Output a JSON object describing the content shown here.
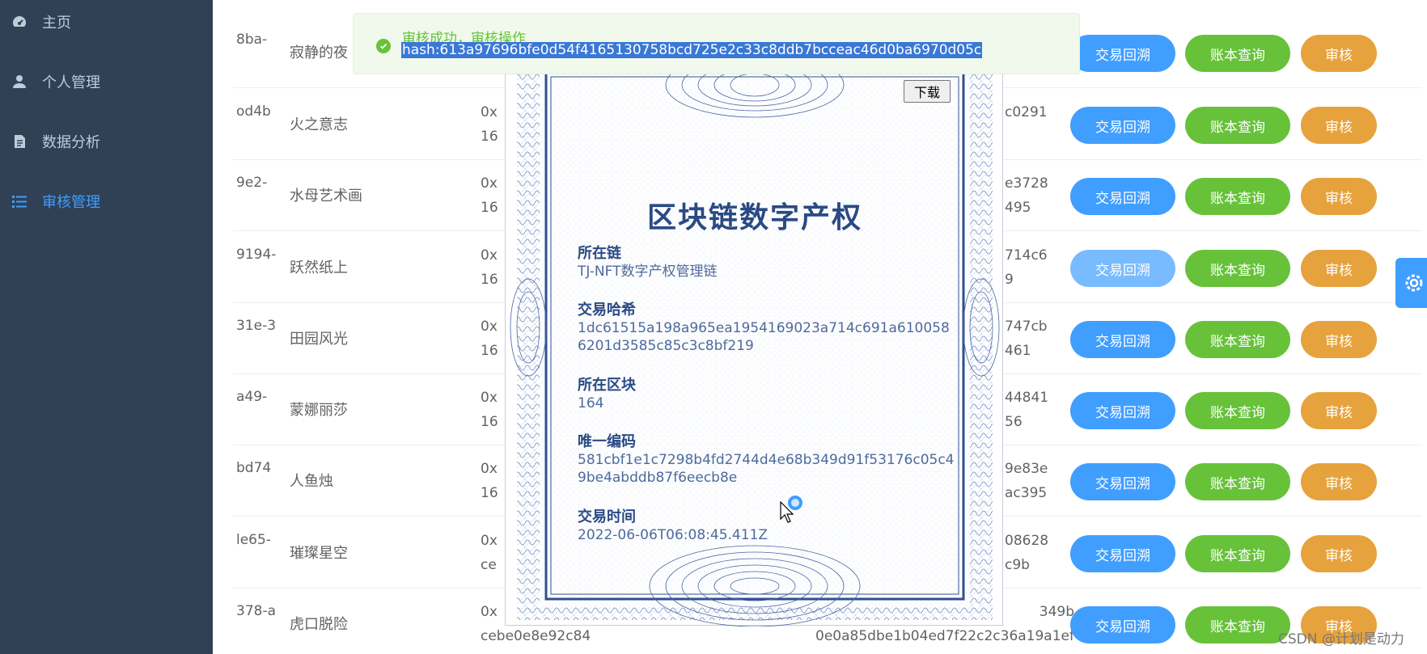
{
  "sidebar": {
    "items": [
      {
        "label": "主页",
        "icon": "dashboard-icon",
        "active": false
      },
      {
        "label": "个人管理",
        "icon": "user-icon",
        "active": false
      },
      {
        "label": "数据分析",
        "icon": "document-icon",
        "active": false
      },
      {
        "label": "审核管理",
        "icon": "list-icon",
        "active": true
      }
    ]
  },
  "table": {
    "rows": [
      {
        "id": "8ba-",
        "name": "寂静的夜",
        "hash1": "",
        "hash2": "",
        "trace": "交易回溯",
        "ledger": "账本查询",
        "audit": "审核"
      },
      {
        "id": "od4b",
        "name": "火之意志",
        "hash1": "0x\n16",
        "hash2": "c0291",
        "trace": "交易回溯",
        "ledger": "账本查询",
        "audit": "审核"
      },
      {
        "id": "9e2-",
        "name": "水母艺术画",
        "hash1": "0x\n16",
        "hash2": "e3728\n495",
        "trace": "交易回溯",
        "ledger": "账本查询",
        "audit": "审核"
      },
      {
        "id": "9194-",
        "name": "跃然纸上",
        "hash1": "0x\n16",
        "hash2": "714c6\n9",
        "trace": "交易回溯",
        "ledger": "账本查询",
        "audit": "审核"
      },
      {
        "id": "31e-3",
        "name": "田园风光",
        "hash1": "0x\n16",
        "hash2": "747cb\n461",
        "trace": "交易回溯",
        "ledger": "账本查询",
        "audit": "审核"
      },
      {
        "id": "a49-",
        "name": "蒙娜丽莎",
        "hash1": "0x\n16",
        "hash2": "44841\n56",
        "trace": "交易回溯",
        "ledger": "账本查询",
        "audit": "审核"
      },
      {
        "id": "bd74",
        "name": "人鱼烛",
        "hash1": "0x\n16",
        "hash2": "9e83e\nac395",
        "trace": "交易回溯",
        "ledger": "账本查询",
        "audit": "审核"
      },
      {
        "id": "le65-",
        "name": "璀璨星空",
        "hash1": "0x\nce",
        "hash2": "08628\nc9b",
        "trace": "交易回溯",
        "ledger": "账本查询",
        "audit": "审核"
      },
      {
        "id": "378-a",
        "name": "虎口脱险",
        "hash1": "0x\ncebe0e8e92c84",
        "hash2": "349b\n00e0a85dbe1b04ed7f22c2c36a19a1ef",
        "trace": "交易回溯",
        "ledger": "账本查询",
        "audit": "审核"
      }
    ]
  },
  "certificate": {
    "title": "区块链数字产权",
    "download": "下载",
    "fields": [
      {
        "label": "所在链",
        "value": "TJ-NFT数字产权管理链"
      },
      {
        "label": "交易哈希",
        "value": "1dc61515a198a965ea1954169023a714c691a6100586201d3585c85c3c8bf219"
      },
      {
        "label": "所在区块",
        "value": "164"
      },
      {
        "label": "唯一编码",
        "value": "581cbf1e1c7298b4fd2744d4e68b349d91f53176c05c49be4abddb87f6eecb8e"
      },
      {
        "label": "交易时间",
        "value": "2022-06-06T06:08:45.411Z"
      }
    ]
  },
  "toast": {
    "title": "审核成功，审核操作",
    "hash": "hash:613a97696bfe0d54f4165130758bcd725e2c33c8ddb7bcceac46d0ba6970d05c"
  },
  "watermark": "CSDN @计划是动力",
  "colors": {
    "sidebar_bg": "#304156",
    "primary": "#409eff",
    "success": "#67c23a",
    "warning": "#e6a23c"
  }
}
